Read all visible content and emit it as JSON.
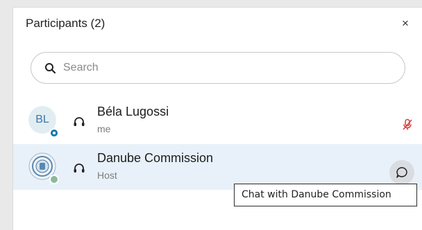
{
  "panel": {
    "title": "Participants (2)",
    "close_label": "×"
  },
  "search": {
    "placeholder": "Search",
    "value": ""
  },
  "participants": [
    {
      "name": "Béla Lugossi",
      "role": "me",
      "initials": "BL",
      "audio_icon": "headset-icon",
      "mic_status": "muted",
      "mic_icon": "mic-off-icon"
    },
    {
      "name": "Danube Commission",
      "role": "Host",
      "avatar": "organization-seal-avatar",
      "audio_icon": "headset-icon",
      "action_icon": "chat-bubble-icon"
    }
  ],
  "tooltip": {
    "text": "Chat with Danube Commission"
  },
  "colors": {
    "selected_row_bg": "#e8f1f9",
    "mic_off_red": "#d93a3a",
    "initials_color": "#3b77a8"
  }
}
